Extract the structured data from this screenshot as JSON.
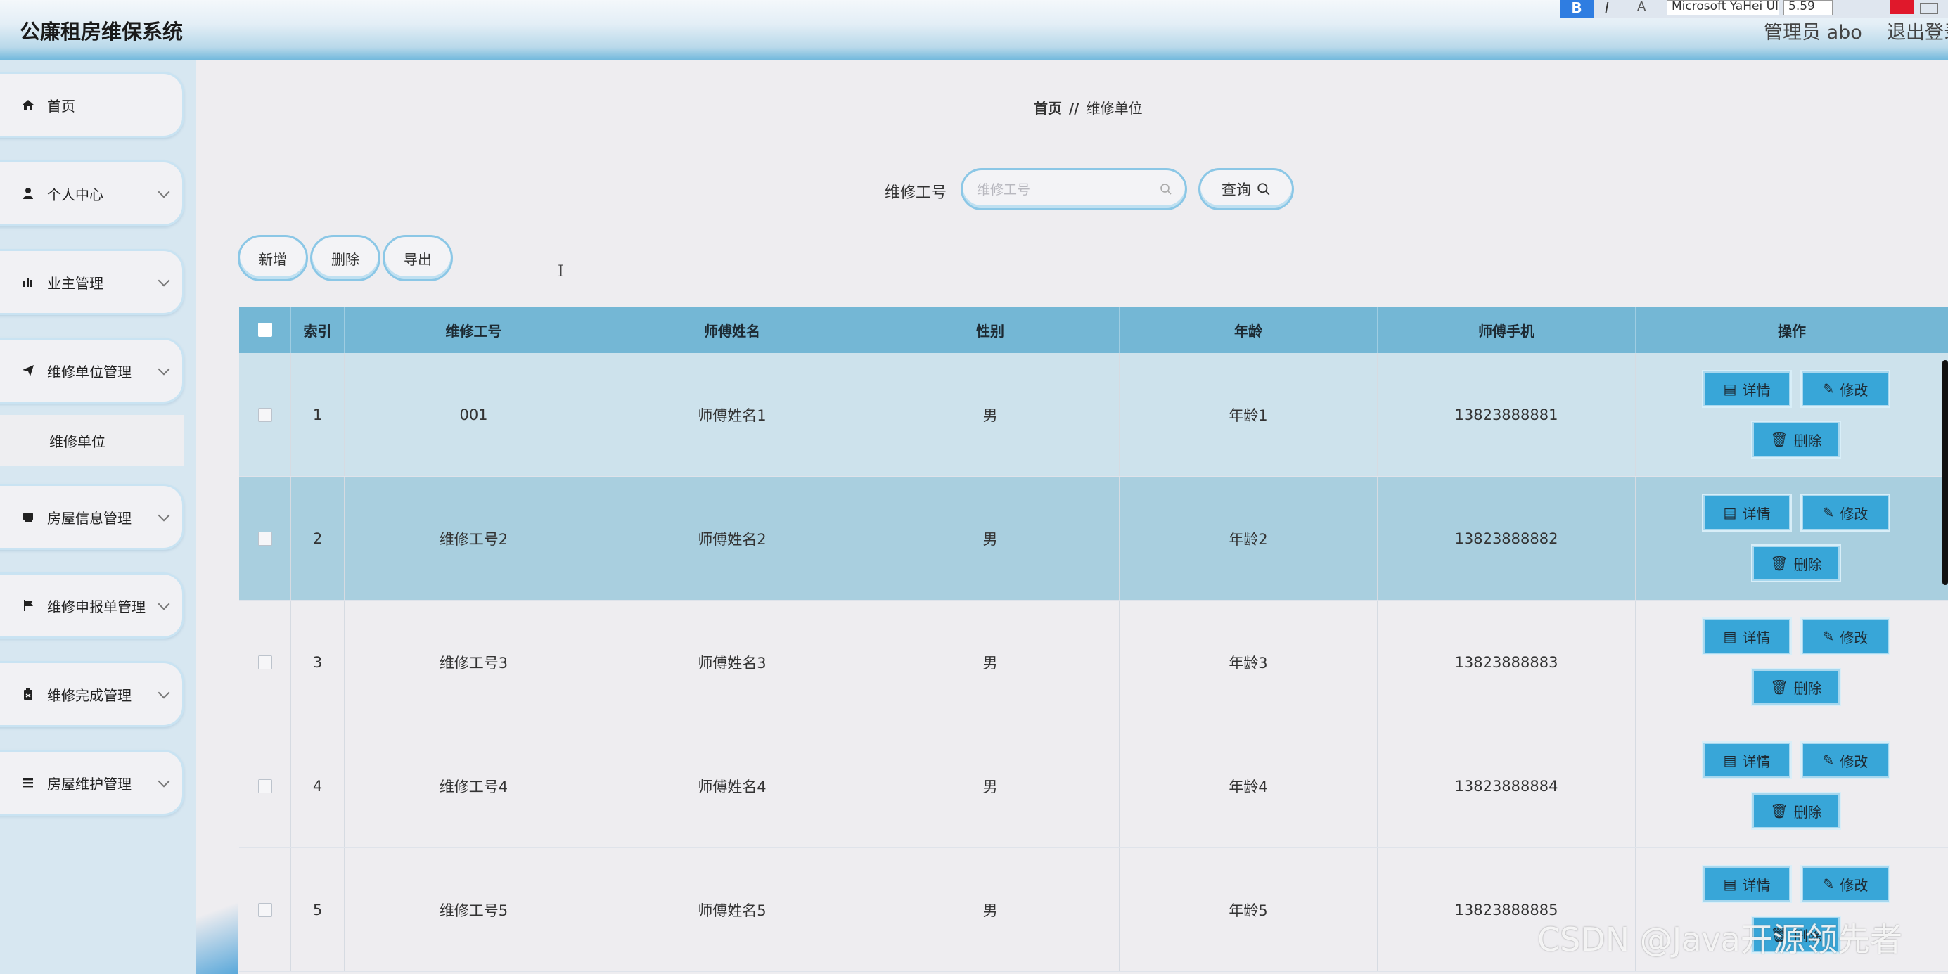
{
  "app": {
    "title": "公廉租房维保系统"
  },
  "editbar": {
    "bold": "B",
    "italic": "I",
    "clear": "A",
    "font": "Microsoft YaHei UI",
    "size": "5.59"
  },
  "header": {
    "user": "管理员 abo",
    "logout": "退出登录"
  },
  "sidebar": {
    "items": [
      {
        "label": "首页",
        "icon": "home-icon"
      },
      {
        "label": "个人中心",
        "icon": "user-icon"
      },
      {
        "label": "业主管理",
        "icon": "bar-chart-icon"
      },
      {
        "label": "维修单位管理",
        "icon": "send-icon"
      },
      {
        "label": "房屋信息管理",
        "icon": "inbox-icon"
      },
      {
        "label": "维修申报单管理",
        "icon": "flag-icon"
      },
      {
        "label": "维修完成管理",
        "icon": "clipboard-icon"
      },
      {
        "label": "房屋维护管理",
        "icon": "list-icon"
      }
    ],
    "sub_item": "维修单位"
  },
  "breadcrumb": {
    "home": "首页",
    "sep": "//",
    "current": "维修单位"
  },
  "search": {
    "label": "维修工号",
    "placeholder": "维修工号",
    "value": "",
    "button": "查询"
  },
  "actions": {
    "add": "新增",
    "delete": "删除",
    "export": "导出"
  },
  "table": {
    "headers": [
      "索引",
      "维修工号",
      "师傅姓名",
      "性别",
      "年龄",
      "师傅手机",
      "操作"
    ],
    "rows": [
      {
        "index": "1",
        "id": "001",
        "name": "师傅姓名1",
        "sex": "男",
        "age": "年龄1",
        "phone": "13823888881"
      },
      {
        "index": "2",
        "id": "维修工号2",
        "name": "师傅姓名2",
        "sex": "男",
        "age": "年龄2",
        "phone": "13823888882"
      },
      {
        "index": "3",
        "id": "维修工号3",
        "name": "师傅姓名3",
        "sex": "男",
        "age": "年龄3",
        "phone": "13823888883"
      },
      {
        "index": "4",
        "id": "维修工号4",
        "name": "师傅姓名4",
        "sex": "男",
        "age": "年龄4",
        "phone": "13823888884"
      },
      {
        "index": "5",
        "id": "维修工号5",
        "name": "师傅姓名5",
        "sex": "男",
        "age": "年龄5",
        "phone": "13823888885"
      }
    ],
    "ops": {
      "detail": "详情",
      "edit": "修改",
      "delete": "删除"
    }
  },
  "watermark": "CSDN @Java开源领先者",
  "colors": {
    "header_bar": "#74b7d5",
    "op_button": "#38a6d8",
    "accent_border": "#8bc7e6"
  }
}
